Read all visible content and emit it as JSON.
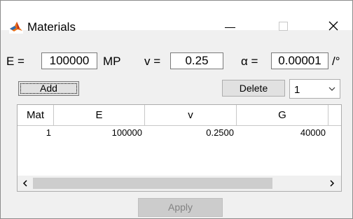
{
  "window": {
    "title": "Materials"
  },
  "params": {
    "E": {
      "label": "E =",
      "value": "100000",
      "unit": "MP"
    },
    "v": {
      "label": "v =",
      "value": "0.25"
    },
    "alpha": {
      "label": "α =",
      "value": "0.00001",
      "unit": "/°"
    }
  },
  "toolbar": {
    "add_label": "Add",
    "delete_label": "Delete",
    "select_value": "1"
  },
  "table": {
    "columns": [
      "Mat",
      "E",
      "v",
      "G"
    ],
    "rows": [
      {
        "mat": "1",
        "E": "100000",
        "v": "0.2500",
        "G": "40000"
      }
    ]
  },
  "footer": {
    "apply_label": "Apply"
  }
}
